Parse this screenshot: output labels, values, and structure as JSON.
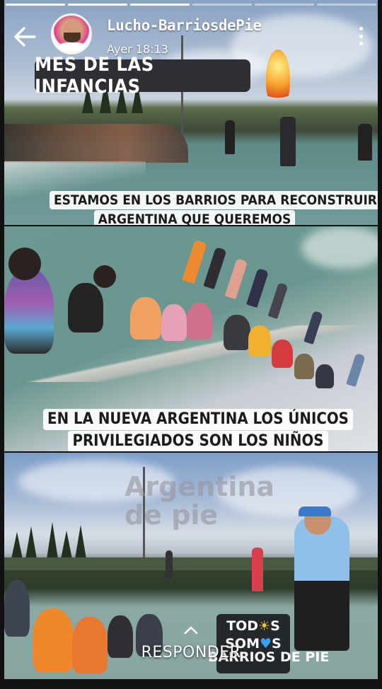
{
  "story": {
    "progress": {
      "segments": 6,
      "viewed": 3
    },
    "author": {
      "name": "Lucho-BarriosdePie",
      "time": "Ayer 18:13"
    },
    "icons": {
      "back": "arrow-left-icon",
      "menu": "more-vertical-icon",
      "reply": "chevron-up-icon"
    },
    "reply_label": "RESPONDER"
  },
  "panels": {
    "panel1": {
      "tag": "MES DE LAS INFANCIAS",
      "caption_lines": [
        "ESTAMOS EN LOS BARRIOS PARA RECONSTRUIR LA",
        "ARGENTINA QUE QUEREMOS"
      ]
    },
    "panel2": {
      "caption_lines": [
        "EN LA NUEVA ARGENTINA LOS ÚNICOS",
        "PRIVILEGIADOS SON LOS NIÑOS"
      ]
    },
    "panel3": {
      "watermark_lines": [
        "Argentina",
        "de pie"
      ],
      "badge_lines": [
        "TOD",
        "S",
        "SOM",
        "S",
        "BARRIOS DE PIE"
      ],
      "badge_emojis": [
        "sun-emoji",
        "blue-heart-emoji"
      ]
    }
  },
  "colors": {
    "caption_bg": "#ffffff",
    "tag_bg": "#2e2f33",
    "badge_bg": "#24282b"
  }
}
